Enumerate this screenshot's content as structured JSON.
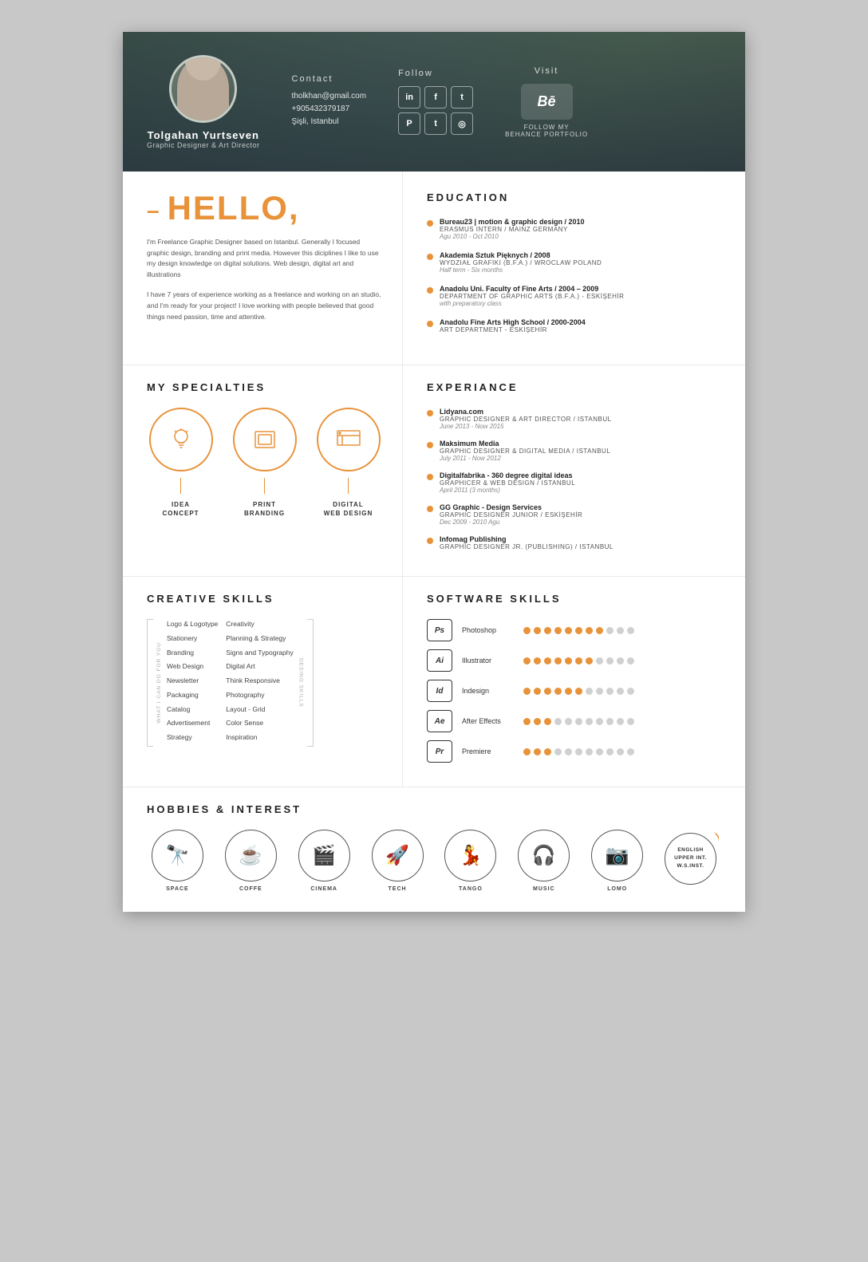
{
  "header": {
    "name": "Tolgahan Yurtseven",
    "title": "Graphic Designer & Art Director",
    "contact": {
      "label": "Contact",
      "email": "tholkhan@gmail.com",
      "phone": "+905432379187",
      "location": "Şişli, Istanbul"
    },
    "follow": {
      "label": "Follow",
      "networks": [
        "in",
        "f",
        "t",
        "P",
        "t",
        "📷"
      ]
    },
    "visit": {
      "label": "Visit",
      "behance_label": "Be",
      "behance_text": "FOLLOW MY\nBEHANCE PORTFOLIO"
    }
  },
  "hello": {
    "title": "HELLO,",
    "body1": "I'm Freelance Graphic Designer based on Istanbul. Generally I focused graphic design, branding and print media. However this diciplines I like to use my design knowledge on digital solutions. Web design, digital art and illustrations",
    "body2": "I have 7 years of experience working as a freelance and working on an studio, and I'm ready for your project! I love working with people believed that good things need passion, time and attentive."
  },
  "education": {
    "title": "EDUCATION",
    "items": [
      {
        "title": "Bureau23 | motion & graphic design / 2010",
        "subtitle": "ERASMUS INTERN / MAINZ GERMANY",
        "date": "Agu 2010 - Oct 2010"
      },
      {
        "title": "Akademia Sztuk Pięknych / 2008",
        "subtitle": "WYDZIAŁ GRAFIKI (B.F.A.) / WROCLAW POLAND",
        "date": "Half term - Six months"
      },
      {
        "title": "Anadolu Uni. Faculty of Fine Arts / 2004 – 2009",
        "subtitle": "DEPARTMENT OF GRAPHIC ARTS (B.F.A.) - ESKİŞEHİR",
        "date": "with preparatory class"
      },
      {
        "title": "Anadolu Fine Arts High School / 2000-2004",
        "subtitle": "ART DEPARTMENT - ESKİŞEHİR",
        "date": ""
      }
    ]
  },
  "specialties": {
    "title": "MY SPECIALTIES",
    "items": [
      {
        "icon": "💡",
        "label": "IDEA\nCONCEPT"
      },
      {
        "icon": "🖨",
        "label": "PRINT\nBRANDING"
      },
      {
        "icon": "🖥",
        "label": "DIGITAL\nWEB DESIGN"
      }
    ]
  },
  "experience": {
    "title": "EXPERIANCE",
    "items": [
      {
        "title": "Lidyana.com",
        "subtitle": "GRAPHIC DESIGNER & ART DIRECTOR / ISTANBUL",
        "date": "June 2013 - Now 2015"
      },
      {
        "title": "Maksimum Media",
        "subtitle": "GRAPHIC DESIGNER & DIGITAL MEDIA / ISTANBUL",
        "date": "July 2011 - Now 2012"
      },
      {
        "title": "Digitalfabrika - 360 degree digital ideas",
        "subtitle": "GRAPHICER & WEB DESIGN / ISTANBUL",
        "date": "April 2011 (3 months)"
      },
      {
        "title": "GG Graphic - Design Services",
        "subtitle": "GRAPHIC DESIGNER JUNIOR / ESKİŞEHİR",
        "date": "Dec 2009 - 2010 Agu"
      },
      {
        "title": "Infomag Publishing",
        "subtitle": "GRAPHIC DESIGNER JR. (PUBLISHING) / ISTANBUL",
        "date": ""
      }
    ]
  },
  "creative_skills": {
    "title": "CREATIVE SKILLS",
    "col1_label": "WHAT I CAN DO FOR YOU",
    "col1_items": [
      "Logo & Logotype",
      "Stationery",
      "Branding",
      "Web Design",
      "Newsletter",
      "Packaging",
      "Catalog",
      "Advertisement",
      "Strategy"
    ],
    "col2_label": "DESING SKILLS",
    "col2_items": [
      "Creativity",
      "Planning & Strategy",
      "Signs and Typography",
      "Digital Art",
      "Think Responsive",
      "Photography",
      "Layout - Grid",
      "Color Sense",
      "Inspiration"
    ]
  },
  "software_skills": {
    "title": "SOFTWARE SKILLS",
    "items": [
      {
        "name": "Photoshop",
        "icon": "Ps",
        "filled": 8,
        "empty": 3
      },
      {
        "name": "Illustrator",
        "icon": "Ai",
        "filled": 7,
        "empty": 4
      },
      {
        "name": "Indesign",
        "icon": "Id",
        "filled": 6,
        "empty": 5
      },
      {
        "name": "After Effects",
        "icon": "Ae",
        "filled": 3,
        "empty": 8
      },
      {
        "name": "Premiere",
        "icon": "Pr",
        "filled": 3,
        "empty": 8
      }
    ]
  },
  "hobbies": {
    "title": "HOBBIES & INTEREST",
    "items": [
      {
        "icon": "🔭",
        "label": "SPACE"
      },
      {
        "icon": "☕",
        "label": "COFFE"
      },
      {
        "icon": "🎬",
        "label": "CINEMA"
      },
      {
        "icon": "🚀",
        "label": "TECH"
      },
      {
        "icon": "💃",
        "label": "TANGO"
      },
      {
        "icon": "🎧",
        "label": "MUSIC"
      },
      {
        "icon": "📷",
        "label": "LOMO"
      },
      {
        "lang": true,
        "label": "ENGLISH\nUPPER INT.\nW.S.INST."
      }
    ]
  }
}
